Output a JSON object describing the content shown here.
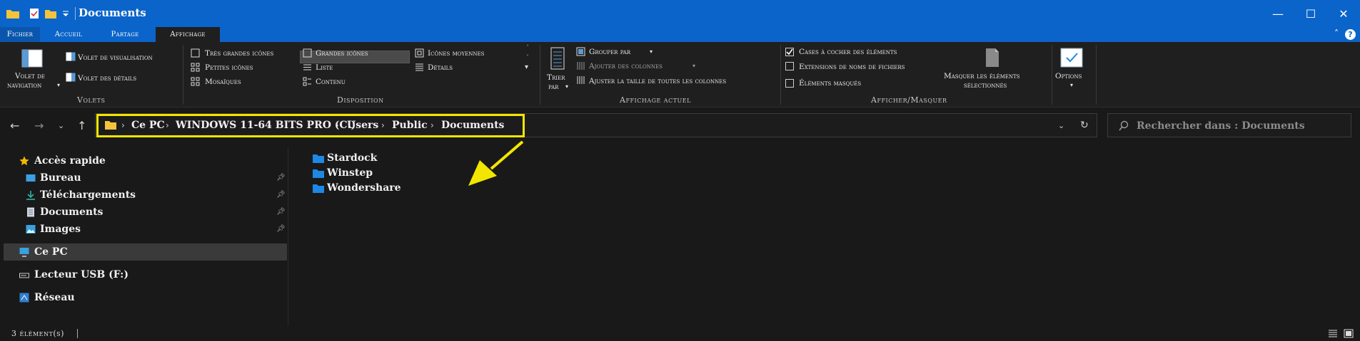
{
  "window": {
    "title": "Documents",
    "minimize_glyph": "—",
    "maximize_glyph": "☐",
    "close_glyph": "✕"
  },
  "ribbon_tabs": [
    {
      "label": "Fichier"
    },
    {
      "label": "Accueil"
    },
    {
      "label": "Partage"
    },
    {
      "label": "Affichage"
    }
  ],
  "help_glyph": "?",
  "collapse_glyph": "˄",
  "ribbon": {
    "volets": {
      "group_label": "Volets",
      "navigation_line1": "Volet de",
      "navigation_line2": "navigation",
      "visualisation": "Volet de visualisation",
      "details": "Volet des détails"
    },
    "disposition": {
      "group_label": "Disposition",
      "tres_grandes": "Très grandes icônes",
      "grandes": "Grandes icônes",
      "moyennes": "Icônes moyennes",
      "petites": "Petites icônes",
      "liste": "Liste",
      "details": "Détails",
      "mosaiques": "Mosaïques",
      "contenu": "Contenu",
      "selected": "Liste"
    },
    "affichage_actuel": {
      "group_label": "Affichage actuel",
      "trier_line1": "Trier",
      "trier_line2": "par",
      "grouper": "Grouper par",
      "ajouter": "Ajouter des colonnes",
      "ajuster": "Ajuster la taille de toutes les colonnes"
    },
    "afficher_masquer": {
      "group_label": "Afficher/Masquer",
      "cases": "Cases à cocher des éléments",
      "extensions": "Extensions de noms de fichiers",
      "masques": "Éléments masqués",
      "masquer_line1": "Masquer les éléments",
      "masquer_line2": "sélectionnés",
      "checked": {
        "cases": true,
        "extensions": false,
        "masques": false
      }
    },
    "options": {
      "label": "Options"
    }
  },
  "address": {
    "crumbs": [
      "Ce PC",
      "WINDOWS 11-64 BITS PRO (C:)",
      "Users",
      "Public",
      "Documents"
    ],
    "search_placeholder": "Rechercher dans : Documents"
  },
  "nav_pane": {
    "quick_access": "Accès rapide",
    "quick_items": [
      "Bureau",
      "Téléchargements",
      "Documents",
      "Images"
    ],
    "this_pc": "Ce PC",
    "usb": "Lecteur USB (F:)",
    "network": "Réseau"
  },
  "files": [
    "Stardock",
    "Winstep",
    "Wondershare"
  ],
  "status": {
    "count": "3 élément(s)"
  },
  "colors": {
    "accent": "#0b64c9",
    "highlight": "#f2e600",
    "folder": "#1e88e5"
  }
}
